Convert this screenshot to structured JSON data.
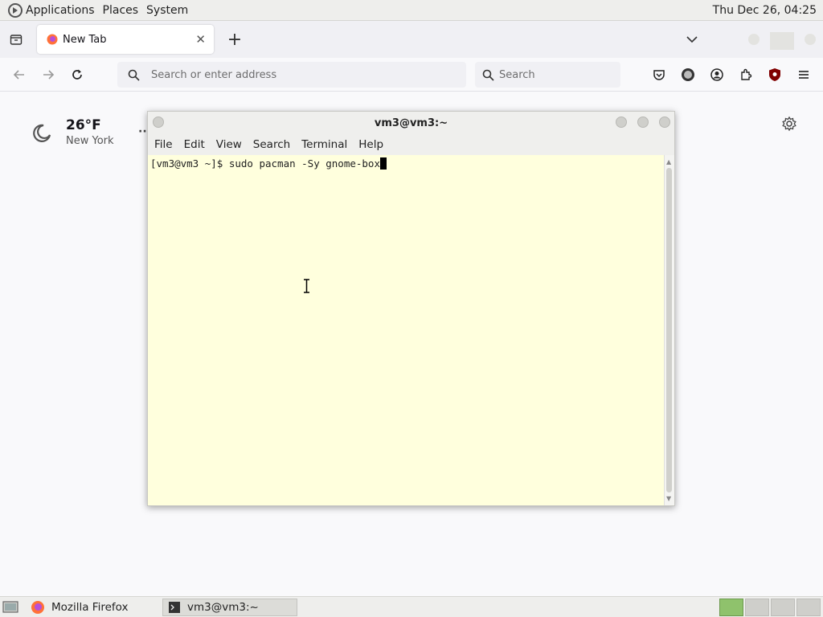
{
  "top_panel": {
    "menus": [
      "Applications",
      "Places",
      "System"
    ],
    "clock": "Thu Dec 26, 04:25"
  },
  "browser": {
    "tab": {
      "title": "New Tab"
    },
    "urlbar_placeholder": "Search or enter address",
    "searchbar_placeholder": "Search"
  },
  "newtab": {
    "weather": {
      "temp": "26°F",
      "city": "New York"
    },
    "dots": "··"
  },
  "terminal": {
    "title": "vm3@vm3:~",
    "menu": [
      "File",
      "Edit",
      "View",
      "Search",
      "Terminal",
      "Help"
    ],
    "prompt": "[vm3@vm3 ~]$ ",
    "command": "sudo pacman -Sy gnome-box"
  },
  "taskbar": {
    "tasks": [
      "Mozilla Firefox",
      "vm3@vm3:~"
    ]
  },
  "colors": {
    "terminal_bg": "#ffffdd",
    "workspace_active": "#8fc26c"
  }
}
